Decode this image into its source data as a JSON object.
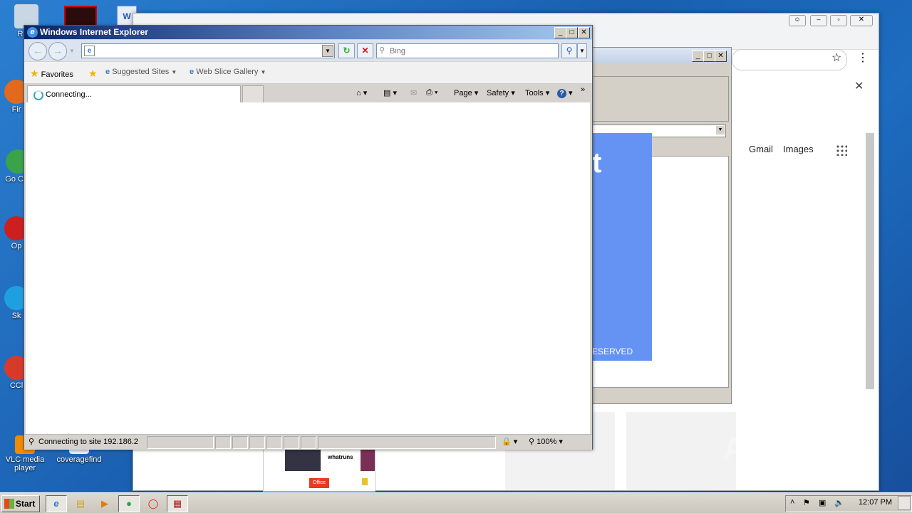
{
  "desktop": {
    "icons": [
      {
        "label": "Recy"
      },
      {
        "label": "Fir"
      },
      {
        "label": "Go Chr"
      },
      {
        "label": "Op"
      },
      {
        "label": "Sk"
      },
      {
        "label": "CCl"
      },
      {
        "label": "VLC media player"
      },
      {
        "label": "coveragefind"
      }
    ]
  },
  "chrome": {
    "gmail_label": "Gmail",
    "images_label": "Images",
    "preview_brand": "whatruns",
    "preview_chip": "Office",
    "apps_icon": "grid-icon"
  },
  "ie2": {
    "partial_title": "t",
    "partial_footer": "ESERVED"
  },
  "ie": {
    "title": "Windows Internet Explorer",
    "address_value": "",
    "search_placeholder": "Bing",
    "favorites_label": "Favorites",
    "suggested_sites": "Suggested Sites",
    "web_slice": "Web Slice Gallery",
    "tab_label": "Connecting...",
    "cmd_page": "Page",
    "cmd_safety": "Safety",
    "cmd_tools": "Tools",
    "status_text": "Connecting to site 192.186.2",
    "zoom": "100%"
  },
  "taskbar": {
    "start_label": "Start",
    "clock": "12:07 PM"
  },
  "watermark": "ANY RUN"
}
